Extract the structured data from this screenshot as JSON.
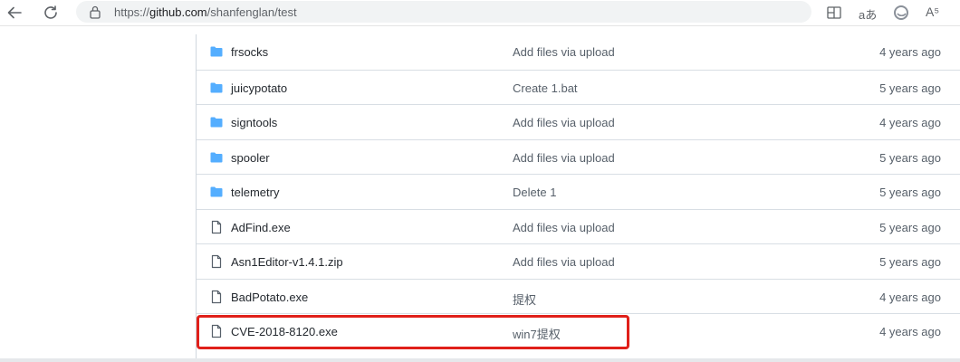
{
  "browser": {
    "url_prefix": "https://",
    "url_host": "github.com",
    "url_path": "/shanfenglan/test",
    "aa_label": "aあ",
    "read_label": "A⁵"
  },
  "files": [
    {
      "type": "folder",
      "name": "frsocks",
      "message": "Add files via upload",
      "age": "4 years ago"
    },
    {
      "type": "folder",
      "name": "juicypotato",
      "message": "Create 1.bat",
      "age": "5 years ago"
    },
    {
      "type": "folder",
      "name": "signtools",
      "message": "Add files via upload",
      "age": "4 years ago"
    },
    {
      "type": "folder",
      "name": "spooler",
      "message": "Add files via upload",
      "age": "5 years ago"
    },
    {
      "type": "folder",
      "name": "telemetry",
      "message": "Delete 1",
      "age": "5 years ago"
    },
    {
      "type": "file",
      "name": "AdFind.exe",
      "message": "Add files via upload",
      "age": "5 years ago"
    },
    {
      "type": "file",
      "name": "Asn1Editor-v1.4.1.zip",
      "message": "Add files via upload",
      "age": "5 years ago"
    },
    {
      "type": "file",
      "name": "BadPotato.exe",
      "message": "提权",
      "age": "4 years ago"
    },
    {
      "type": "file",
      "name": "CVE-2018-8120.exe",
      "message": "win7提权",
      "age": "4 years ago"
    }
  ],
  "colors": {
    "folder_icon": "#54aeff",
    "file_icon": "#57606a",
    "highlight_box": "#e0201a"
  }
}
